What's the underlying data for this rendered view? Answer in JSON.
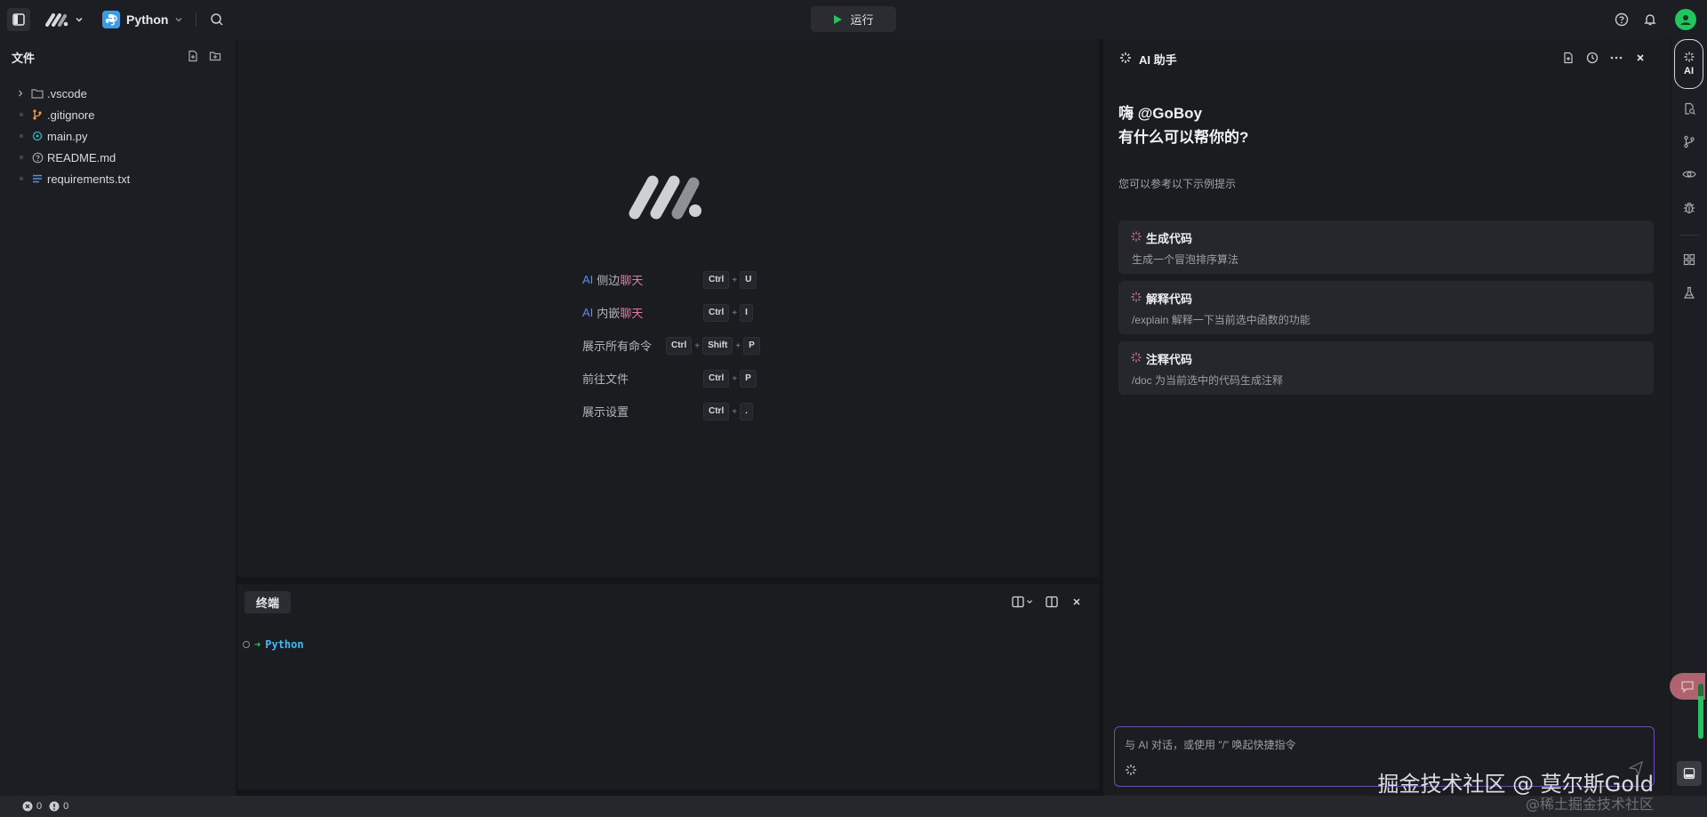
{
  "topbar": {
    "language": "Python",
    "run_label": "运行"
  },
  "sidebar": {
    "title": "文件",
    "files": [
      {
        "name": ".vscode",
        "icon": "folder-icon"
      },
      {
        "name": ".gitignore",
        "icon": "git-icon"
      },
      {
        "name": "main.py",
        "icon": "python-file-icon"
      },
      {
        "name": "README.md",
        "icon": "info-icon"
      },
      {
        "name": "requirements.txt",
        "icon": "text-lines-icon"
      }
    ]
  },
  "editor": {
    "shortcuts": [
      {
        "prefix": "AI",
        "mid": "侧边",
        "suffix": "聊天",
        "keys": [
          "Ctrl",
          "U"
        ]
      },
      {
        "prefix": "AI",
        "mid": "内嵌",
        "suffix": "聊天",
        "keys": [
          "Ctrl",
          "I"
        ]
      },
      {
        "label": "展示所有命令",
        "keys": [
          "Ctrl",
          "Shift",
          "P"
        ]
      },
      {
        "label": "前往文件",
        "keys": [
          "Ctrl",
          "P"
        ]
      },
      {
        "label": "展示设置",
        "keys": [
          "Ctrl",
          "."
        ]
      }
    ]
  },
  "terminal": {
    "tab_label": "终端",
    "prompt_text": "Python"
  },
  "ai_panel": {
    "title": "AI 助手",
    "greeting_line1": "嗨 @GoBoy",
    "greeting_line2": "有什么可以帮你的?",
    "hint": "您可以参考以下示例提示",
    "prompts": [
      {
        "title": "生成代码",
        "desc": "生成一个冒泡排序算法"
      },
      {
        "title": "解释代码",
        "desc": "/explain 解释一下当前选中函数的功能"
      },
      {
        "title": "注释代码",
        "desc": "/doc 为当前选中的代码生成注释"
      }
    ],
    "input_placeholder": "与 AI 对话，或使用 \"/\" 唤起快捷指令"
  },
  "activity_bar": {
    "ai_label": "AI"
  },
  "statusbar": {
    "errors": "0",
    "warnings": "0"
  },
  "watermark": {
    "main": "掘金技术社区 @ 莫尔斯Gold",
    "sub": "@稀土掘金技术社区"
  },
  "colors": {
    "accent_blue": "#5b8def",
    "accent_pink": "#e07ba6",
    "accent_green": "#22c55e",
    "accent_cyan": "#38bdf8",
    "input_border": "#6a4fb0"
  }
}
